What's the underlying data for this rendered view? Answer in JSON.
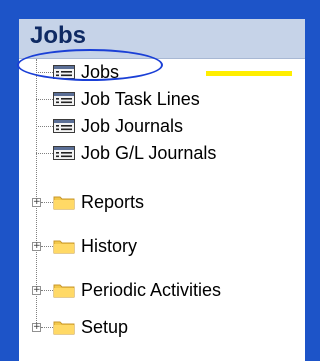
{
  "pane": {
    "title": "Jobs"
  },
  "tree": {
    "pages": [
      {
        "label": "Jobs",
        "icon": "list-page-icon"
      },
      {
        "label": "Job Task Lines",
        "icon": "list-page-icon"
      },
      {
        "label": "Job Journals",
        "icon": "list-page-icon"
      },
      {
        "label": "Job G/L Journals",
        "icon": "list-page-icon"
      }
    ],
    "folders": [
      {
        "label": "Reports",
        "icon": "folder-icon",
        "expander": "+"
      },
      {
        "label": "History",
        "icon": "folder-icon",
        "expander": "+"
      },
      {
        "label": "Periodic Activities",
        "icon": "folder-icon",
        "expander": "+"
      },
      {
        "label": "Setup",
        "icon": "folder-icon",
        "expander": "+"
      }
    ]
  },
  "annotations": {
    "circle_color": "#1a3fd6",
    "bar_color": "#ffee00"
  }
}
